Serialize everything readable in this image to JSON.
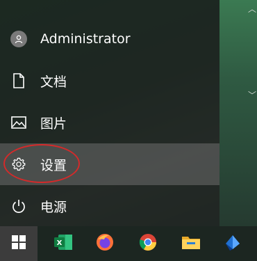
{
  "start_menu": {
    "items": [
      {
        "label": "Administrator",
        "icon": "user-avatar-icon"
      },
      {
        "label": "文档",
        "icon": "document-icon"
      },
      {
        "label": "图片",
        "icon": "pictures-icon"
      },
      {
        "label": "设置",
        "icon": "settings-gear-icon",
        "highlighted": true
      },
      {
        "label": "电源",
        "icon": "power-icon"
      }
    ]
  },
  "annotation": {
    "color": "#d42a2a"
  },
  "taskbar": {
    "apps": [
      {
        "name": "start-button",
        "icon": "windows-logo-icon"
      },
      {
        "name": "excel",
        "icon": "excel-icon"
      },
      {
        "name": "firefox",
        "icon": "firefox-icon"
      },
      {
        "name": "chrome",
        "icon": "chrome-icon"
      },
      {
        "name": "file-explorer",
        "icon": "folder-icon"
      },
      {
        "name": "app",
        "icon": "blue-app-icon"
      }
    ]
  }
}
